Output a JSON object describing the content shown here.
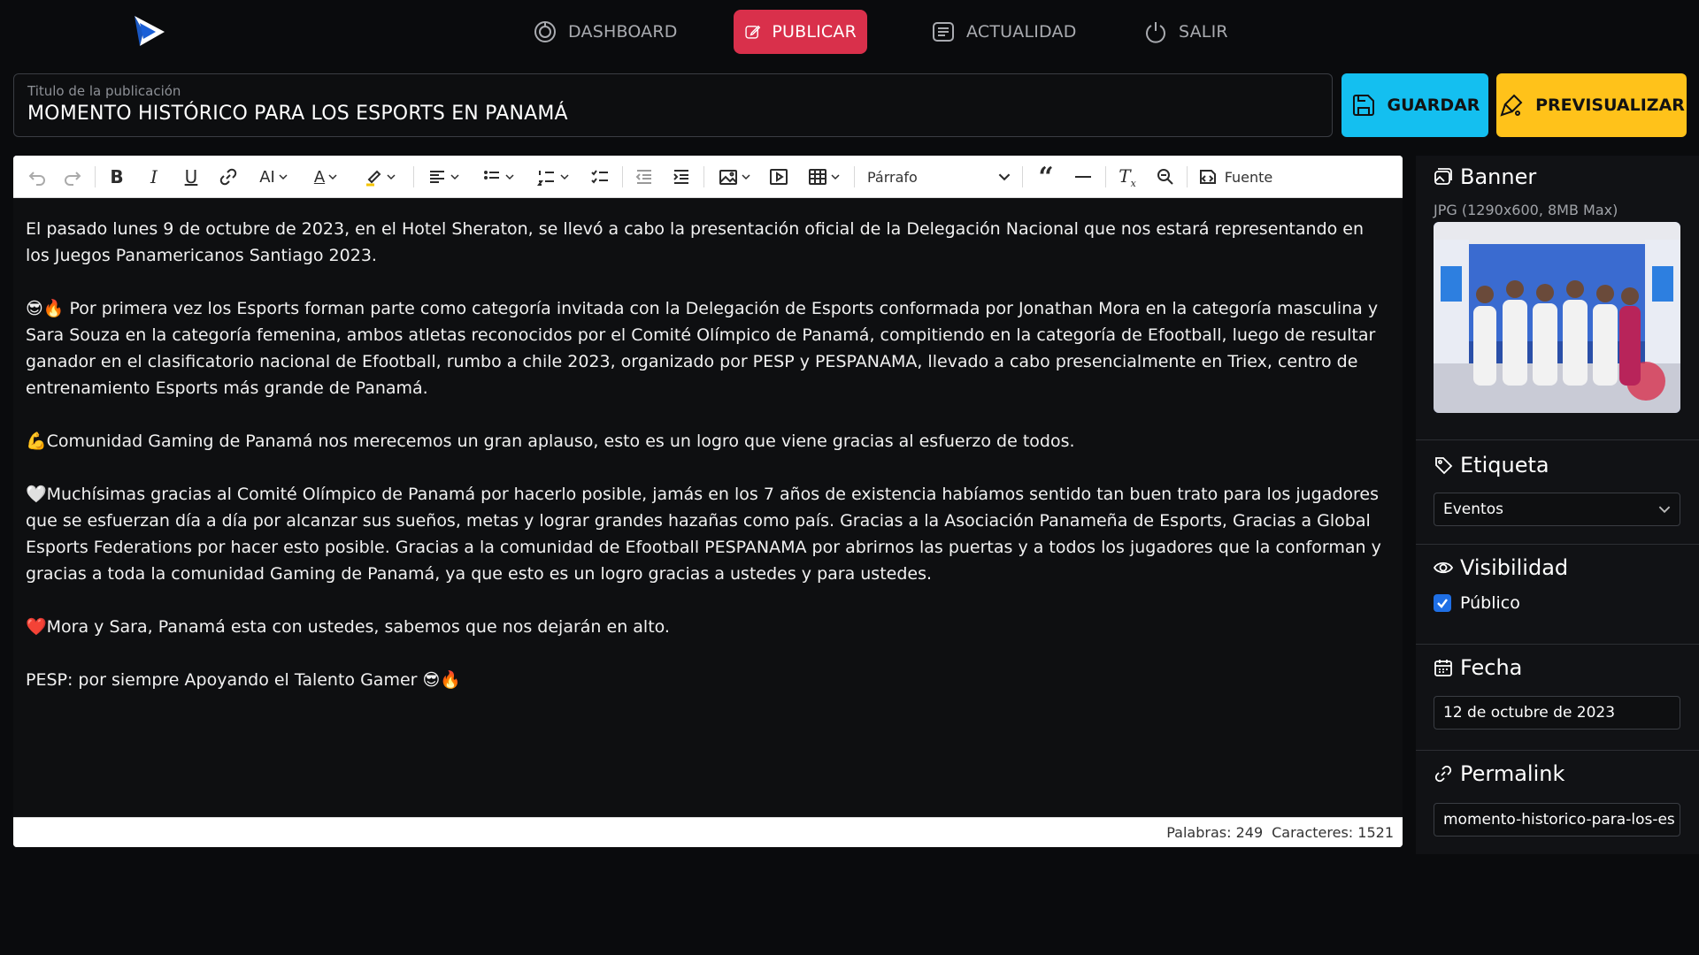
{
  "nav": {
    "items": [
      {
        "label": "DASHBOARD",
        "icon": "dashboard-gauge-icon"
      },
      {
        "label": "PUBLICAR",
        "icon": "edit-square-icon",
        "active": true
      },
      {
        "label": "ACTUALIDAD",
        "icon": "news-icon"
      },
      {
        "label": "SALIR",
        "icon": "power-icon"
      }
    ]
  },
  "title_field": {
    "label": "Titulo de la publicación",
    "value": "MOMENTO HISTÓRICO PARA LOS ESPORTS EN PANAMÁ"
  },
  "actions": {
    "save_label": "GUARDAR",
    "preview_label": "PREVISUALIZAR"
  },
  "colors": {
    "accent_red": "#d9304b",
    "save_cyan": "#14bff0",
    "preview_yellow": "#ffc21a",
    "checkbox_blue": "#1f6fe5"
  },
  "toolbar": {
    "paragraph_select": "Párrafo",
    "source_label": "Fuente"
  },
  "content": {
    "paragraphs": [
      "El pasado lunes 9 de octubre de 2023, en el Hotel Sheraton, se llevó a cabo la presentación oficial de la Delegación Nacional que nos estará representando en los Juegos Panamericanos Santiago 2023.",
      "😎🔥 Por primera vez los Esports forman parte como categoría invitada con la Delegación de Esports conformada por Jonathan Mora en la categoría masculina y Sara Souza en la categoría femenina, ambos atletas reconocidos por el Comité Olímpico de Panamá, compitiendo en la categoría de Efootball, luego de resultar ganador en el clasificatorio nacional de Efootball, rumbo a chile 2023, organizado por PESP y PESPANAMA, llevado a cabo presencialmente en Triex, centro de entrenamiento Esports más grande de Panamá.",
      "💪Comunidad Gaming de Panamá nos merecemos un gran aplauso, esto es un logro que viene gracias al esfuerzo de todos.",
      "🤍Muchísimas gracias al Comité Olímpico de Panamá por hacerlo posible, jamás en los 7 años de existencia habíamos sentido tan buen trato para los jugadores que se esfuerzan día a día por alcanzar sus sueños, metas y lograr grandes hazañas como país. Gracias a la Asociación Panameña de Esports, Gracias a Global Esports Federations por hacer esto posible. Gracias a la comunidad de Efootball PESPANAMA por abrirnos las puertas y a todos los jugadores que la conforman y gracias a toda la comunidad Gaming de Panamá, ya que esto es un logro gracias a ustedes y para ustedes.",
      "❤️Mora y Sara, Panamá esta con ustedes, sabemos que nos dejarán en alto.",
      "PESP: por siempre Apoyando el Talento Gamer 😎🔥"
    ]
  },
  "status": {
    "words": "Palabras: 249",
    "chars": "Caracteres: 1521"
  },
  "sidebar": {
    "banner": {
      "title": "Banner",
      "hint": "JPG (1290x600, 8MB Max)"
    },
    "tag": {
      "title": "Etiqueta",
      "value": "Eventos"
    },
    "visibility": {
      "title": "Visibilidad",
      "option": "Público",
      "checked": true
    },
    "date": {
      "title": "Fecha",
      "value": "12 de octubre de 2023"
    },
    "permalink": {
      "title": "Permalink",
      "value": "momento-historico-para-los-es"
    }
  }
}
